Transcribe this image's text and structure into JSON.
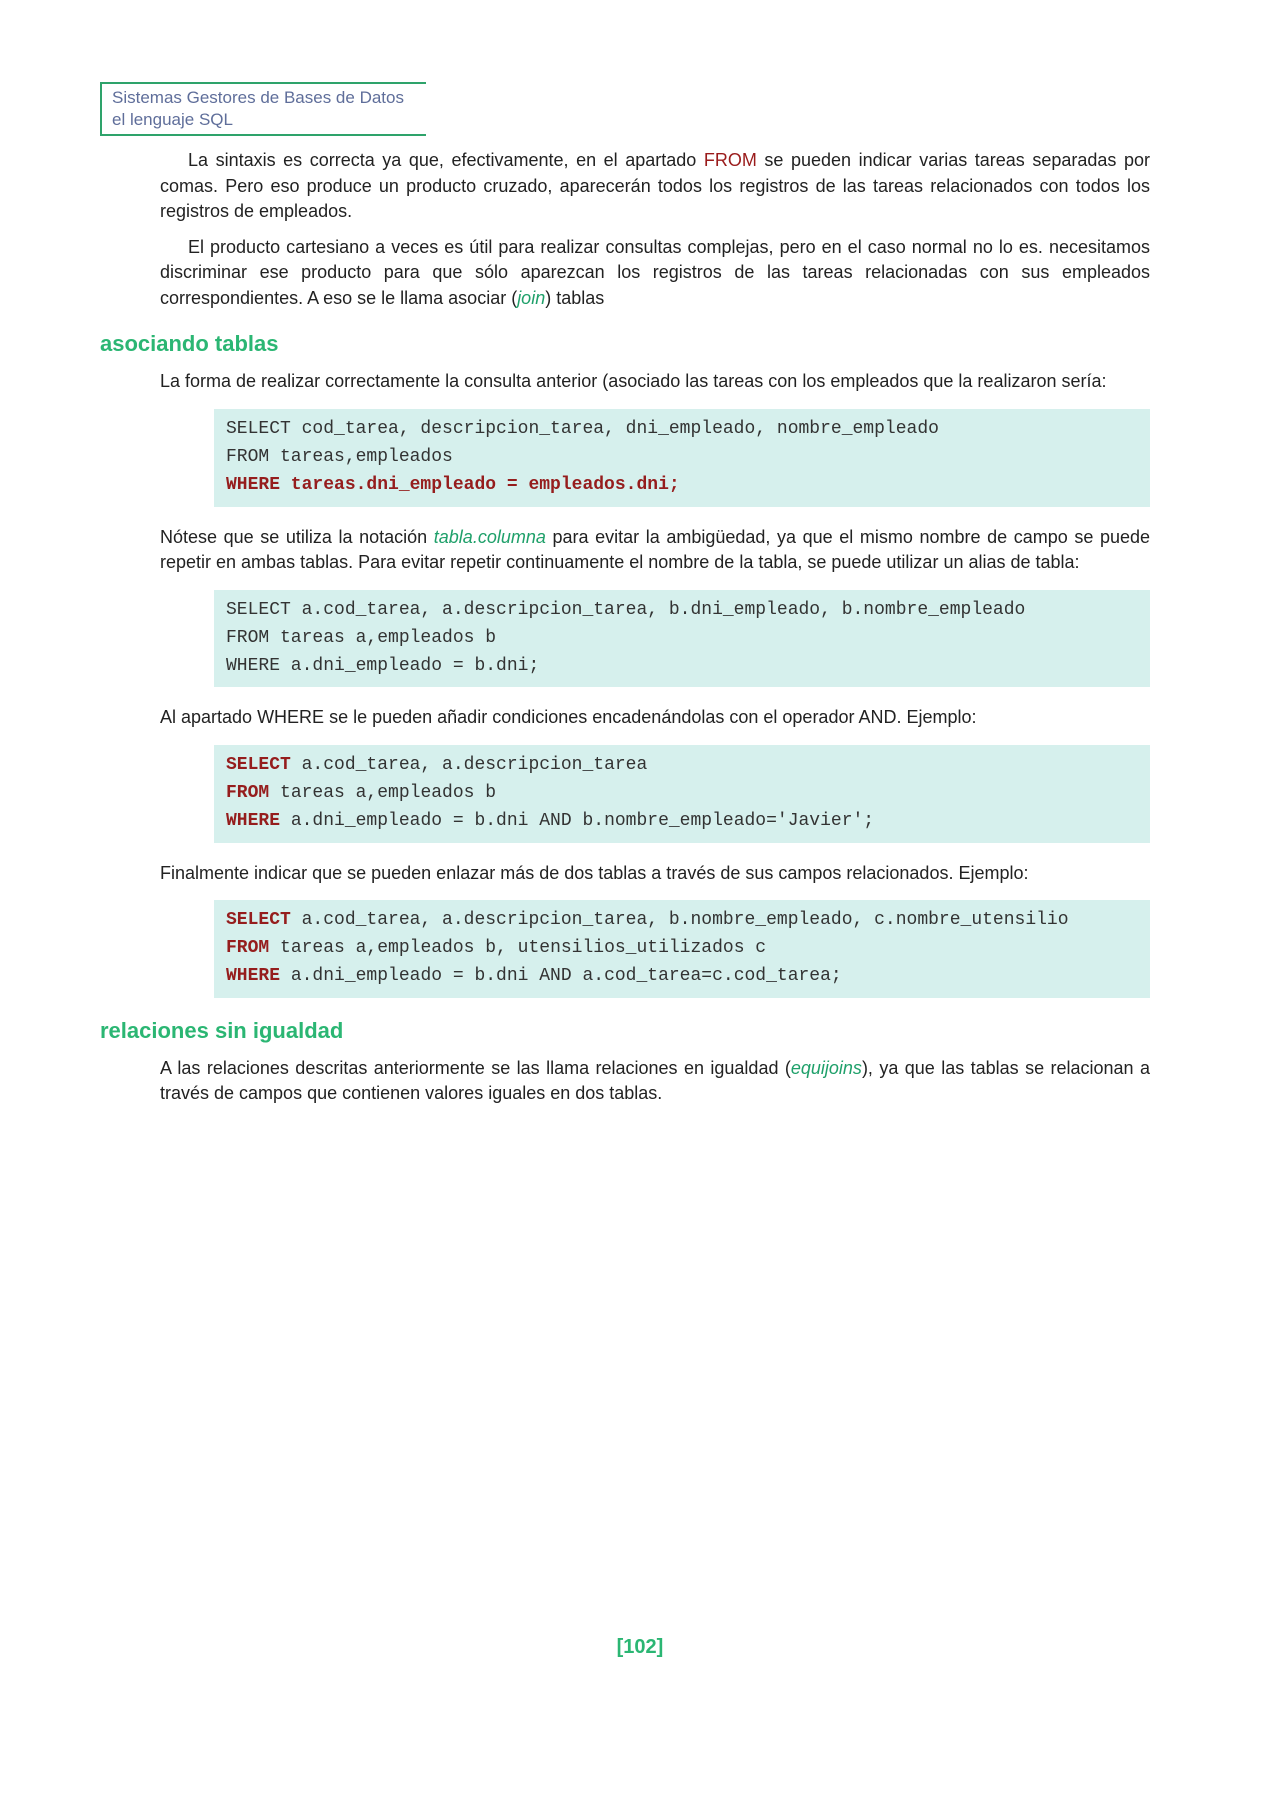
{
  "header": {
    "line1": "Sistemas Gestores de Bases de Datos",
    "line2": "el lenguaje SQL"
  },
  "p1a": "La sintaxis es correcta ya que, efectivamente, en el apartado ",
  "p1_from": "FROM",
  "p1b": " se pueden indicar varias tareas separadas por comas. Pero eso produce un producto cruzado, aparecerán todos los registros de las tareas relacionados con todos los registros de empleados.",
  "p2a": "El producto cartesiano a veces es útil para realizar consultas complejas, pero en el caso normal no lo es. necesitamos discriminar ese producto para que sólo aparezcan los registros de las tareas relacionadas con sus empleados correspondientes. A eso se le llama asociar (",
  "p2_join": "join",
  "p2b": ") tablas",
  "section1": "asociando tablas",
  "p3": "La forma de realizar correctamente la consulta anterior (asociado las tareas con los empleados que la realizaron sería:",
  "code1": {
    "l1": "SELECT cod_tarea, descripcion_tarea, dni_empleado, nombre_empleado",
    "l2": "FROM tareas,empleados",
    "l3": "WHERE tareas.dni_empleado = empleados.dni;"
  },
  "p4a": "Nótese que se utiliza la notación ",
  "p4_tabla": "tabla.columna",
  "p4b": " para evitar la ambigüedad, ya que el mismo nombre de campo se puede repetir en ambas tablas. Para evitar repetir continuamente el nombre de la tabla, se puede utilizar un alias de tabla:",
  "code2": {
    "l1": "SELECT a.cod_tarea, a.descripcion_tarea, b.dni_empleado, b.nombre_empleado",
    "l2": "FROM tareas a,empleados b",
    "l3": "WHERE a.dni_empleado = b.dni;"
  },
  "p5": "Al apartado WHERE se le pueden añadir condiciones encadenándolas con el operador AND. Ejemplo:",
  "code3": {
    "kw1": "SELECT",
    "r1": " a.cod_tarea, a.descripcion_tarea",
    "kw2": "FROM",
    "r2": " tareas a,empleados b",
    "kw3": "WHERE",
    "r3": " a.dni_empleado = b.dni AND b.nombre_empleado='Javier';"
  },
  "p6": "Finalmente indicar que se pueden enlazar más de dos tablas a través de sus campos relacionados. Ejemplo:",
  "code4": {
    "kw1": "SELECT",
    "r1": " a.cod_tarea, a.descripcion_tarea, b.nombre_empleado, c.nombre_utensilio",
    "kw2": "FROM",
    "r2": " tareas a,empleados b, utensilios_utilizados c",
    "kw3": "WHERE",
    "r3": " a.dni_empleado = b.dni AND a.cod_tarea=c.cod_tarea;"
  },
  "section2": "relaciones sin igualdad",
  "p7a": "A las relaciones descritas anteriormente se las llama relaciones en igualdad (",
  "p7_equi": "equijoins",
  "p7b": "), ya que las tablas se relacionan a través de campos que contienen valores iguales en dos tablas.",
  "page_number": "[102]"
}
